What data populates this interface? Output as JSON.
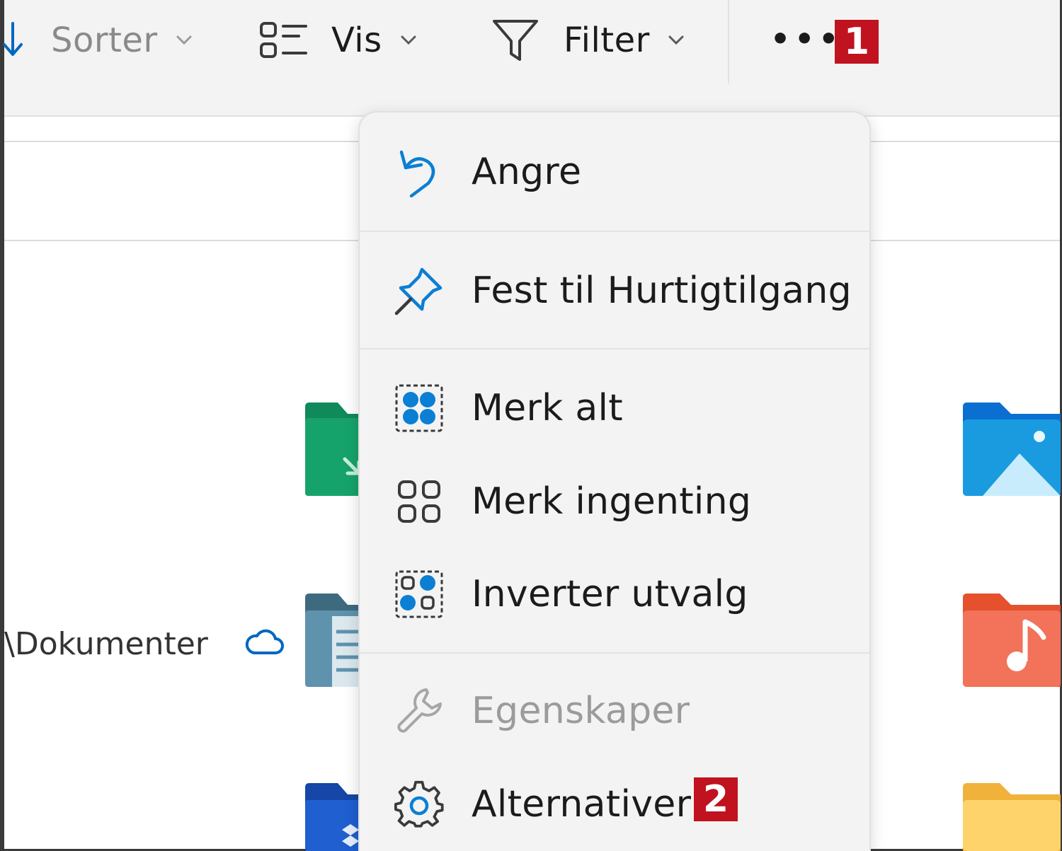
{
  "toolbar": {
    "sort_label": "Sorter",
    "view_label": "Vis",
    "filter_label": "Filter",
    "more_label": "•••",
    "badge_1": "1"
  },
  "content": {
    "path_text": "\\Dokumenter"
  },
  "menu": {
    "undo_label": "Angre",
    "pin_label": "Fest til Hurtigtilgang",
    "select_all_label": "Merk alt",
    "select_none_label": "Merk ingenting",
    "invert_label": "Inverter utvalg",
    "properties_label": "Egenskaper",
    "options_label": "Alternativer",
    "badge_2": "2"
  },
  "colors": {
    "accent": "#0067c0",
    "badge": "#c1121f",
    "menu_bg": "#f3f3f3",
    "disabled_text": "#9b9b9b"
  }
}
